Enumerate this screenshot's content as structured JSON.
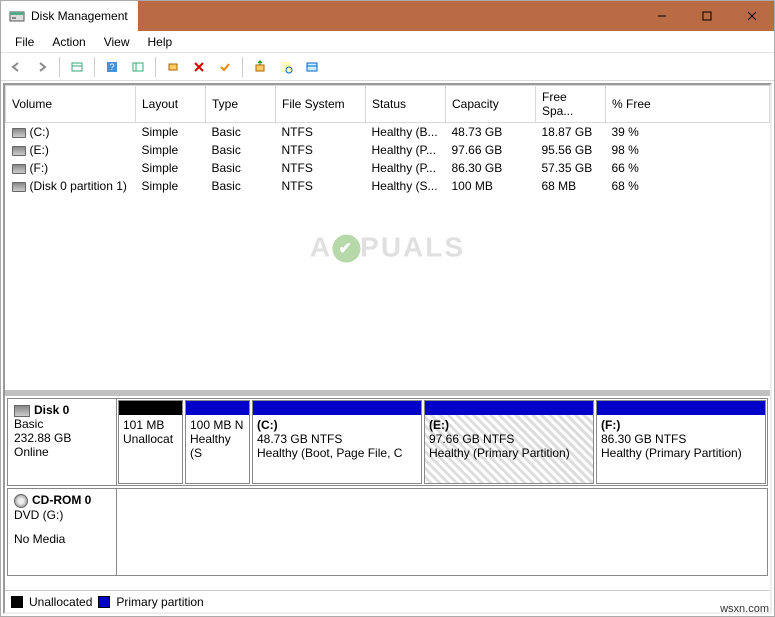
{
  "window": {
    "title": "Disk Management"
  },
  "menu": {
    "file": "File",
    "action": "Action",
    "view": "View",
    "help": "Help"
  },
  "columns": {
    "volume": "Volume",
    "layout": "Layout",
    "type": "Type",
    "filesystem": "File System",
    "status": "Status",
    "capacity": "Capacity",
    "freespace": "Free Spa...",
    "pctfree": "% Free"
  },
  "volumes": [
    {
      "name": "(C:)",
      "layout": "Simple",
      "type": "Basic",
      "fs": "NTFS",
      "status": "Healthy (B...",
      "capacity": "48.73 GB",
      "free": "18.87 GB",
      "pct": "39 %"
    },
    {
      "name": "(E:)",
      "layout": "Simple",
      "type": "Basic",
      "fs": "NTFS",
      "status": "Healthy (P...",
      "capacity": "97.66 GB",
      "free": "95.56 GB",
      "pct": "98 %"
    },
    {
      "name": "(F:)",
      "layout": "Simple",
      "type": "Basic",
      "fs": "NTFS",
      "status": "Healthy (P...",
      "capacity": "86.30 GB",
      "free": "57.35 GB",
      "pct": "66 %"
    },
    {
      "name": "(Disk 0 partition 1)",
      "layout": "Simple",
      "type": "Basic",
      "fs": "NTFS",
      "status": "Healthy (S...",
      "capacity": "100 MB",
      "free": "68 MB",
      "pct": "68 %"
    }
  ],
  "disks": [
    {
      "name": "Disk 0",
      "type": "Basic",
      "size": "232.88 GB",
      "state": "Online",
      "icon": "disk",
      "partitions": [
        {
          "label_line1": "",
          "label_line2": "101 MB",
          "label_line3": "Unallocat",
          "header": "unalloc",
          "width": 60,
          "selected": false
        },
        {
          "label_line1": "",
          "label_line2": "100 MB N",
          "label_line3": "Healthy (S",
          "header": "primary",
          "width": 60,
          "selected": false
        },
        {
          "label_line1": "(C:)",
          "label_line2": "48.73 GB NTFS",
          "label_line3": "Healthy (Boot, Page File, C",
          "header": "primary",
          "width": 160,
          "selected": false
        },
        {
          "label_line1": "(E:)",
          "label_line2": "97.66 GB NTFS",
          "label_line3": "Healthy (Primary Partition)",
          "header": "primary",
          "width": 160,
          "selected": true
        },
        {
          "label_line1": "(F:)",
          "label_line2": "86.30 GB NTFS",
          "label_line3": "Healthy (Primary Partition)",
          "header": "primary",
          "width": 160,
          "selected": false
        }
      ]
    },
    {
      "name": "CD-ROM 0",
      "type": "DVD (G:)",
      "size": "",
      "state": "No Media",
      "icon": "cdrom",
      "partitions": []
    }
  ],
  "legend": {
    "unallocated": "Unallocated",
    "primary": "Primary partition"
  },
  "watermark": {
    "left": "A",
    "right": "PUALS"
  },
  "footer_watermark": "wsxn.com"
}
